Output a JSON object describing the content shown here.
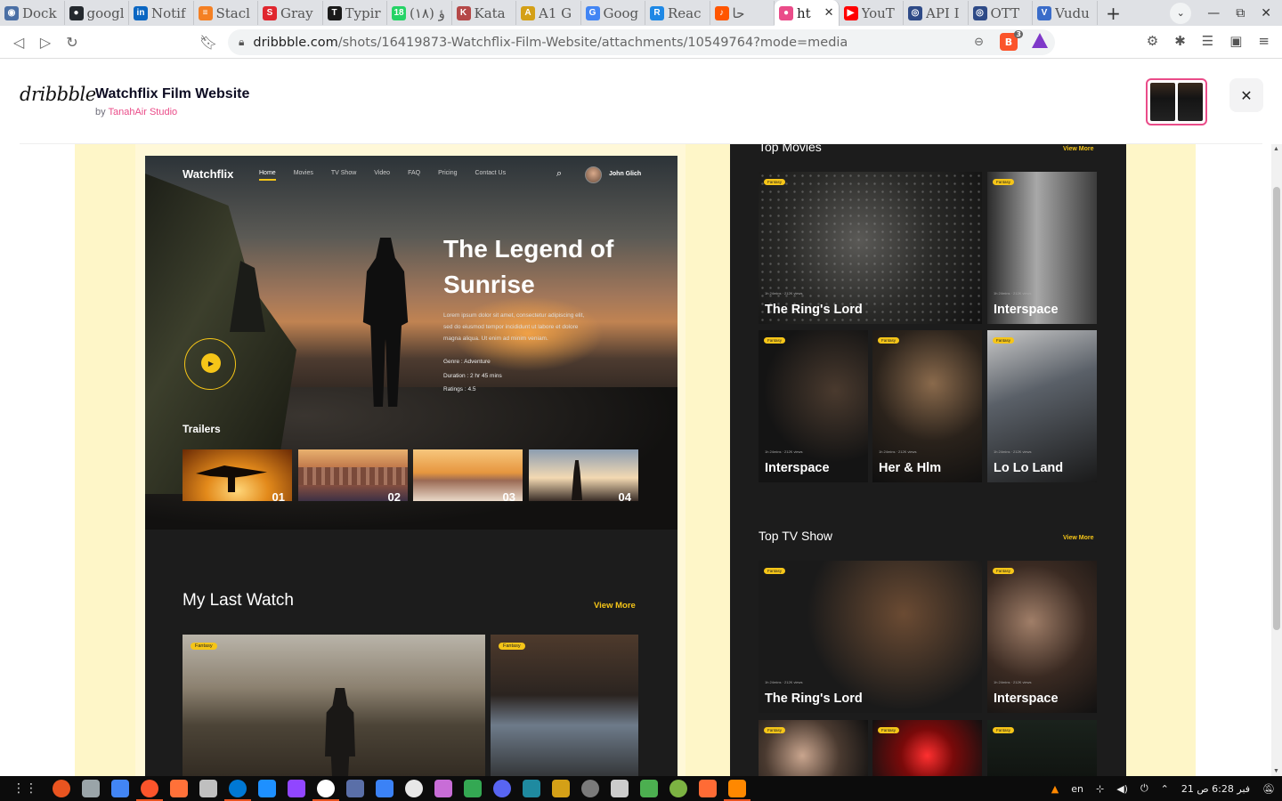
{
  "browser": {
    "tabs": [
      {
        "label": "Dock",
        "color": "#4a6fa5",
        "glyph": "◉"
      },
      {
        "label": "googl",
        "color": "#24292e",
        "glyph": "●"
      },
      {
        "label": "Notif",
        "color": "#0a66c2",
        "glyph": "in"
      },
      {
        "label": "Stacl",
        "color": "#f48024",
        "glyph": "≡"
      },
      {
        "label": "Gray",
        "color": "#e0262e",
        "glyph": "S"
      },
      {
        "label": "Typir",
        "color": "#1a1a1a",
        "glyph": "T"
      },
      {
        "label": "(١٨) ؤ",
        "color": "#25d366",
        "glyph": "18"
      },
      {
        "label": "Kata",
        "color": "#b54848",
        "glyph": "K"
      },
      {
        "label": "A1 G",
        "color": "#d4a017",
        "glyph": "A"
      },
      {
        "label": "Goog",
        "color": "#4285f4",
        "glyph": "G"
      },
      {
        "label": "Reac",
        "color": "#1e88e5",
        "glyph": "R"
      },
      {
        "label": "حا",
        "color": "#ff5500",
        "glyph": "♪"
      },
      {
        "label": "ht",
        "color": "#ea4c89",
        "glyph": "●",
        "active": true
      },
      {
        "label": "YouT",
        "color": "#ff0000",
        "glyph": "▶"
      },
      {
        "label": "API I",
        "color": "#2e4a87",
        "glyph": "◎"
      },
      {
        "label": "OTT",
        "color": "#2e4a87",
        "glyph": "◎"
      },
      {
        "label": "Vudu",
        "color": "#3a6cc9",
        "glyph": "V"
      }
    ],
    "url_host": "dribbble.com",
    "url_path": "/shots/16419873-Watchflix-Film-Website/attachments/10549764?mode=media",
    "brave_badge": "3"
  },
  "dribbble": {
    "logo": "dribbble",
    "shot_title": "Watchflix Film Website",
    "by": "by",
    "author": "TanahAir Studio"
  },
  "site": {
    "brand": "Watchflix",
    "nav": [
      "Home",
      "Movies",
      "TV Show",
      "Video",
      "FAQ",
      "Pricing",
      "Contact Us"
    ],
    "user": "John Glich",
    "hero_title": "The Legend of Sunrise",
    "hero_desc": "Lorem ipsum dolor sit amet, consectetur adipiscing elit, sed do eiusmod tempor incididunt ut labore et dolore magna aliqua. Ut enim ad minim veniam.",
    "genre": "Genre : Adventure",
    "duration": "Duration : 2 hr 45 mins",
    "ratings": "Ratings : 4.5",
    "trailers_title": "Trailers",
    "trailers": [
      "01",
      "02",
      "03",
      "04"
    ],
    "last_watch_title": "My Last Watch",
    "view_more": "View More",
    "tag": "Fantasy"
  },
  "site2": {
    "top_movies": "Top Movies",
    "top_tv": "Top TV Show",
    "view_more": "View More",
    "tag": "Fantasy",
    "meta": "1h 24mins · 212K views",
    "movies": [
      "The Ring's Lord",
      "Interspace",
      "Interspace",
      "Her & Hlm",
      "Lo Lo Land"
    ],
    "shows": [
      "The Ring's Lord",
      "Interspace"
    ]
  },
  "taskbar": {
    "lang": "en",
    "clock": "6:28 ص",
    "date": "21 فبر",
    "icons": [
      "#e95420",
      "#9aa4a8",
      "#4285f4",
      "#fb542b",
      "#ff7139",
      "#bfbfbf",
      "#0078d4",
      "#1e90ff",
      "#9146ff",
      "#ffffff",
      "#5a6fa8",
      "#3b82f6",
      "#e8e8e8",
      "#c86dd7",
      "#34a853",
      "#5865f2",
      "#1f8aa0",
      "#d4a017",
      "#7a7a7a",
      "#cccccc",
      "#4caf50",
      "#7cb342",
      "#ff6b35",
      "#ff8800"
    ]
  }
}
